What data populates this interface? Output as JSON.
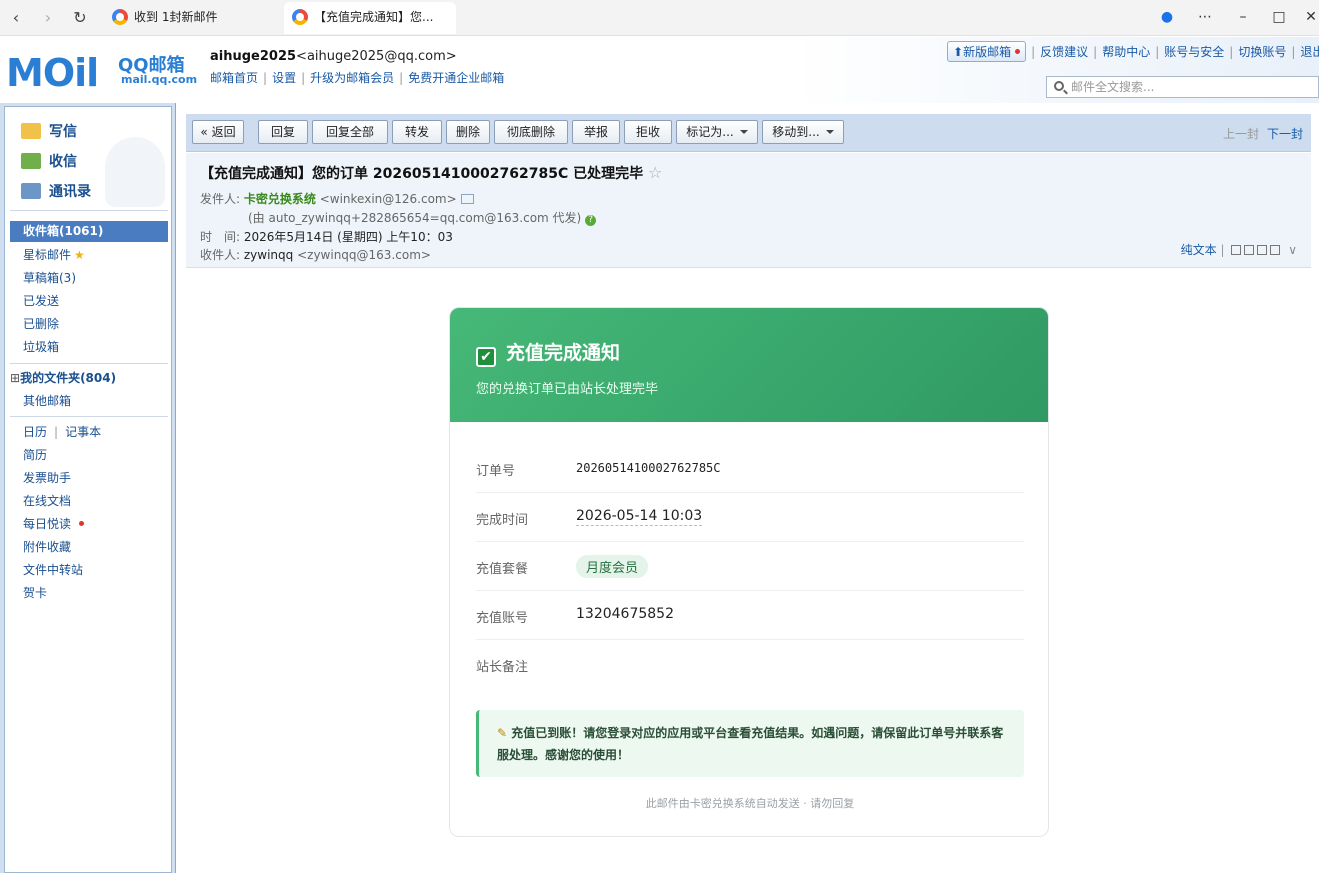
{
  "browser": {
    "tabs": [
      {
        "label": "收到 1封新邮件"
      },
      {
        "label": "【充值完成通知】您..."
      }
    ]
  },
  "header": {
    "logo_text": "MOil",
    "logo_brand": "QQ邮箱",
    "logo_url": "mail.qq.com",
    "account_name": "aihuge2025",
    "account_email": "<aihuge2025@qq.com>",
    "links": [
      "邮箱首页",
      "设置",
      "升级为邮箱会员",
      "免费开通企业邮箱"
    ],
    "new_version": "新版邮箱",
    "right_links": [
      "反馈建议",
      "帮助中心",
      "账号与安全",
      "切换账号",
      "退出"
    ],
    "search_placeholder": "邮件全文搜索..."
  },
  "sidebar": {
    "write": "写信",
    "receive": "收信",
    "contacts": "通讯录",
    "folders": [
      "收件箱(1061)",
      "星标邮件",
      "草稿箱(3)",
      "已发送",
      "已删除",
      "垃圾箱"
    ],
    "my_folders": "我的文件夹(804)",
    "other": "其他邮箱",
    "tools": [
      "日历",
      "记事本",
      "简历",
      "发票助手",
      "在线文档",
      "每日悦读",
      "附件收藏",
      "文件中转站",
      "贺卡"
    ]
  },
  "toolbar": {
    "back": "« 返回",
    "reply": "回复",
    "reply_all": "回复全部",
    "forward": "转发",
    "delete": "删除",
    "delete_perm": "彻底删除",
    "report": "举报",
    "reject": "拒收",
    "mark_as": "标记为...",
    "move_to": "移动到...",
    "prev": "上一封",
    "next": "下一封"
  },
  "mail": {
    "subject": "【充值完成通知】您的订单 2026051410002762785C 已处理完毕",
    "from_label": "发件人:",
    "from_name": "卡密兑换系统",
    "from_email": "<winkexin@126.com>",
    "via": "(由 auto_zywinqq+282865654=qq.com@163.com 代发)",
    "time_label": "时　间:",
    "time": "2026年5月14日 (星期四) 上午10：03",
    "to_label": "收件人:",
    "to_name": "zywinqq",
    "to_email": "<zywinqq@163.com>",
    "plain_text": "纯文本"
  },
  "card": {
    "title": "充值完成通知",
    "subtitle": "您的兑换订单已由站长处理完毕",
    "rows": [
      {
        "key": "订单号",
        "value": "2026051410002762785C"
      },
      {
        "key": "完成时间",
        "value": "2026-05-14 10:03"
      },
      {
        "key": "充值套餐",
        "value": "月度会员"
      },
      {
        "key": "充值账号",
        "value": "13204675852"
      },
      {
        "key": "站长备注",
        "value": ""
      }
    ],
    "note": "充值已到账！请您登录对应的应用或平台查看充值结果。如遇问题，请保留此订单号并联系客服处理。感谢您的使用！",
    "footer": "此邮件由卡密兑换系统自动发送 · 请勿回复"
  },
  "colors": {
    "accent_green": "#46b877",
    "link_blue": "#1a5aa6"
  }
}
